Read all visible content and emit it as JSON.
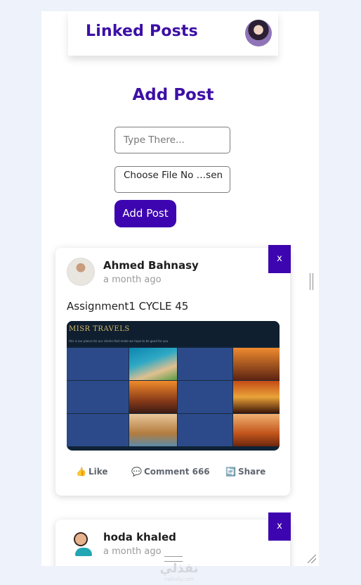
{
  "navbar": {
    "brand": "Linked Posts",
    "profile_avatar_icon": "user-avatar-icon"
  },
  "add_post": {
    "heading": "Add Post",
    "text_placeholder": "Type There...",
    "file_input_label": "Choose File No …sen",
    "submit_label": "Add Post"
  },
  "posts": [
    {
      "author": "Ahmed Bahnasy",
      "time": "a month ago",
      "body": "Assignment1 CYCLE 45",
      "close_label": "x",
      "image": {
        "title": "MISR TRAVELS",
        "subtitle": "this is our places for our clients that made we hope to be good for you"
      },
      "actions": {
        "like": "Like",
        "comment": "Comment 666",
        "share": "Share"
      }
    },
    {
      "author": "hoda khaled",
      "time": "a month ago",
      "close_label": "x"
    }
  ],
  "watermark": {
    "text": "نفذلي",
    "sub": "nafezly.com"
  },
  "colors": {
    "brand": "#3d0fa6",
    "button": "#3d05b0",
    "muted_text": "#9a9a9a",
    "page_background": "#eef2fa"
  }
}
